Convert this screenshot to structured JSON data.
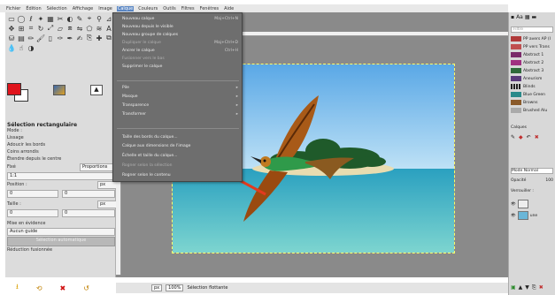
{
  "menubar": {
    "items": [
      "Fichier",
      "Édition",
      "Sélection",
      "Affichage",
      "Image",
      "Calque",
      "Couleurs",
      "Outils",
      "Filtres",
      "Fenêtres",
      "Aide"
    ],
    "active_index": 5
  },
  "calque_menu": {
    "items": [
      {
        "label": "Nouveau calque",
        "shortcut": "Maj+Ctrl+N",
        "disabled": false
      },
      {
        "label": "Nouveau depuis le visible",
        "shortcut": "",
        "disabled": false
      },
      {
        "label": "Nouveau groupe de calques",
        "shortcut": "",
        "disabled": false
      },
      {
        "label": "Dupliquer le calque",
        "shortcut": "Maj+Ctrl+D",
        "disabled": true
      },
      {
        "label": "Ancrer le calque",
        "shortcut": "Ctrl+H",
        "disabled": false
      },
      {
        "label": "Fusionner vers le bas",
        "shortcut": "",
        "disabled": true
      },
      {
        "label": "Supprimer le calque",
        "shortcut": "",
        "disabled": false
      },
      {
        "label": "Pile",
        "shortcut": "▸",
        "disabled": false
      },
      {
        "label": "Masque",
        "shortcut": "▸",
        "disabled": false
      },
      {
        "label": "Transparence",
        "shortcut": "▸",
        "disabled": false
      },
      {
        "label": "Transformer",
        "shortcut": "▸",
        "disabled": false
      },
      {
        "label": "Taille des bords du calque...",
        "shortcut": "",
        "disabled": false
      },
      {
        "label": "Calque aux dimensions de l'image",
        "shortcut": "",
        "disabled": false
      },
      {
        "label": "Échelle et taille du calque...",
        "shortcut": "",
        "disabled": false
      },
      {
        "label": "Rogner selon la sélection",
        "shortcut": "",
        "disabled": true
      },
      {
        "label": "Rogner selon le contenu",
        "shortcut": "",
        "disabled": false
      }
    ]
  },
  "toolbox": {
    "options_title": "Sélection rectangulaire",
    "mode_label": "Mode :",
    "antialias": "Lissage",
    "feather": "Adoucir les bords",
    "rounded": "Coins arrondis",
    "expand": "Étendre depuis le centre",
    "fixed_label": "Fixé",
    "fixed_value": "Proportions",
    "ratio": "1:1",
    "position_label": "Position :",
    "position_unit": "px",
    "position_x": "0",
    "position_y": "0",
    "size_label": "Taille :",
    "size_unit": "px",
    "size_w": "0",
    "size_h": "0",
    "highlight": "Mise en évidence",
    "guides": "Aucun guide",
    "auto_shrink": "Sélection automatique",
    "shrink_merged": "Réduction fusionnée"
  },
  "dock": {
    "filter_placeholder": "Filtre",
    "gradients": [
      {
        "name": "PP avers AP (I",
        "color": "#b03a3a"
      },
      {
        "name": "PP vers Trans",
        "color": "#c05050"
      },
      {
        "name": "Abstract 1",
        "color": "#7a2a6a"
      },
      {
        "name": "Abstract 2",
        "color": "#a03080"
      },
      {
        "name": "Abstract 3",
        "color": "#2f6a3a"
      },
      {
        "name": "Aneurism",
        "color": "#5a3a7a"
      },
      {
        "name": "Blinds",
        "color": "#444444"
      },
      {
        "name": "Blue Green",
        "color": "#2a8a8a"
      },
      {
        "name": "Browns",
        "color": "#8a5a2a"
      },
      {
        "name": "Brushed Alu",
        "color": "#aaaaaa"
      }
    ],
    "layers_tab": "Calques",
    "mode_label": "Mode",
    "mode_value": "Normal",
    "opacity_label": "Opacité",
    "opacity_value": "100",
    "lock_label": "Verrouiller :",
    "layer_name": "une"
  },
  "statusbar": {
    "unit": "px",
    "zoom": "100%",
    "message": "Sélection flottante"
  },
  "colors": {
    "fg": "#e0141c",
    "bg": "#ffffff",
    "menu_bg": "#6e6e6e",
    "arrow": "#e33a1e"
  }
}
